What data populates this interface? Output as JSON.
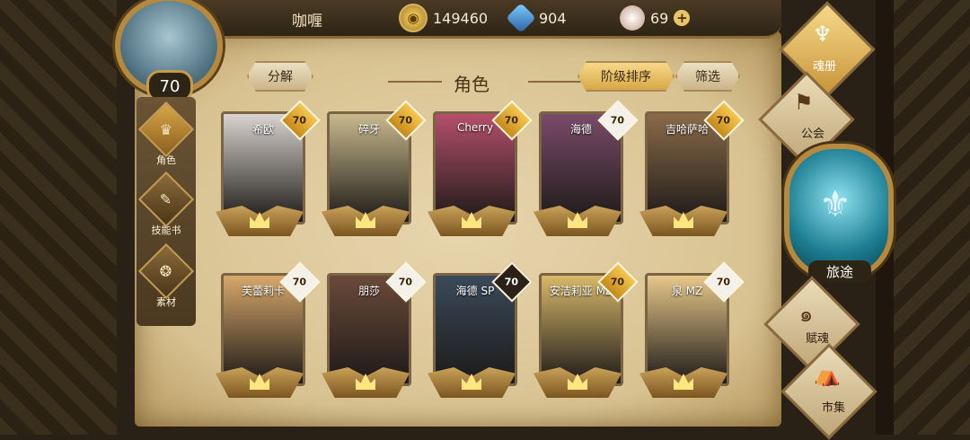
{
  "player": {
    "name": "咖喱",
    "level": "70"
  },
  "resources": {
    "coins": "149460",
    "crystals": "904",
    "gems": "69",
    "plus": "+"
  },
  "sidenav": [
    {
      "label": "角色",
      "icon": "helmet-icon",
      "glyph": "♛"
    },
    {
      "label": "技能书",
      "icon": "book-icon",
      "glyph": "✎"
    },
    {
      "label": "素材",
      "icon": "beast-icon",
      "glyph": "❂"
    }
  ],
  "header": {
    "title": "角色",
    "decompose": "分解",
    "sort": "阶级排序",
    "filter": "筛选"
  },
  "cards": [
    {
      "name": "希欧",
      "level": "70",
      "badge": "gold",
      "color": "#d9d4cf"
    },
    {
      "name": "碎牙",
      "level": "70",
      "badge": "gold",
      "color": "#c8b98c"
    },
    {
      "name": "Cherry",
      "level": "70",
      "badge": "gold",
      "color": "#b4506a"
    },
    {
      "name": "海德",
      "level": "70",
      "badge": "white",
      "color": "#7a4b6a"
    },
    {
      "name": "吉哈萨哈",
      "level": "70",
      "badge": "gold",
      "color": "#8a6a4a"
    },
    {
      "name": "芙蕾莉卡",
      "level": "70",
      "badge": "white",
      "color": "#d8a86a"
    },
    {
      "name": "朋莎",
      "level": "70",
      "badge": "white",
      "color": "#6a4a3a"
    },
    {
      "name": "海德 SP",
      "level": "70",
      "badge": "dark",
      "color": "#3a4a5a"
    },
    {
      "name": "安洁莉亚 MZ",
      "level": "70",
      "badge": "gold",
      "color": "#d8b86a"
    },
    {
      "name": "泉 MZ",
      "level": "70",
      "badge": "white",
      "color": "#e8c88a"
    }
  ],
  "rightmenu": {
    "soul": "魂册",
    "guild": "公会",
    "journey": "旅途",
    "fusion": "赋魂",
    "market": "市集"
  }
}
